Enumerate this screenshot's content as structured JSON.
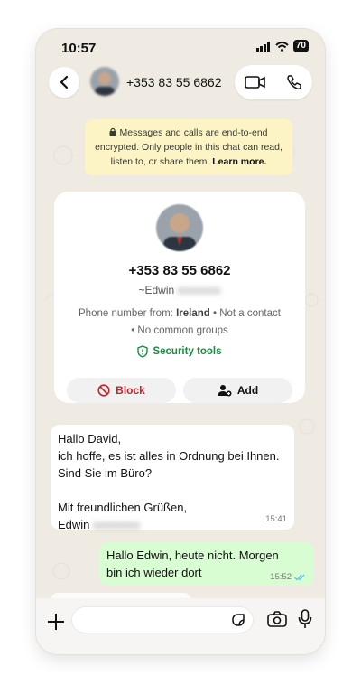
{
  "status": {
    "time": "10:57",
    "battery": "70"
  },
  "header": {
    "contact_number": "+353 83 55 6862"
  },
  "notice": {
    "text": "Messages and calls are end-to-end encrypted. Only people in this chat can read, listen to, or share them.",
    "link": "Learn more."
  },
  "card": {
    "phone": "+353 83 55 6862",
    "name_prefix": "~Edwin",
    "phone_from_label": "Phone number from:",
    "country": "Ireland",
    "not_contact": "• Not a contact",
    "groups": "• No common groups",
    "security": "Security tools",
    "block": "Block",
    "add": "Add"
  },
  "messages": {
    "incoming": {
      "line1": "Hallo David,",
      "line2": "ich hoffe, es ist alles in Ordnung bei Ihnen.",
      "line3": "Sind Sie im Büro?",
      "line4": "Mit freundlichen Grüßen,",
      "line5": "Edwin",
      "time": "15:41"
    },
    "outgoing": {
      "line1": "Hallo Edwin, heute nicht. Morgen",
      "line2": "bin ich wieder dort",
      "time": "15:52"
    }
  },
  "colors": {
    "bg": "#efeae2",
    "outgoing": "#d9fdd3",
    "notice": "#fdf4c5",
    "security": "#1d8a42",
    "block": "#c0262d",
    "read_ticks": "#53bdeb"
  },
  "icons": [
    "back-icon",
    "video-call-icon",
    "phone-icon",
    "lock-icon",
    "shield-icon",
    "block-icon",
    "add-contact-icon",
    "read-ticks-icon",
    "plus-icon",
    "sticker-icon",
    "camera-icon",
    "mic-icon"
  ]
}
